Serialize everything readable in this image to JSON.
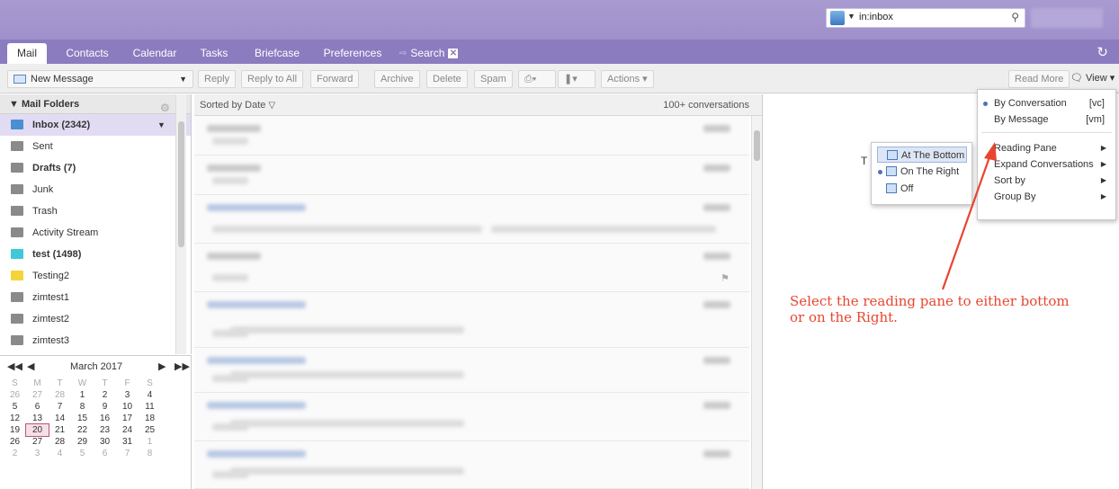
{
  "header": {
    "search": {
      "value": "in:inbox",
      "type_icon": "mail-search-type-icon",
      "search_icon": "magnifier-icon"
    },
    "search_button": ""
  },
  "tabs": [
    {
      "label": "Mail",
      "active": true
    },
    {
      "label": "Contacts"
    },
    {
      "label": "Calendar"
    },
    {
      "label": "Tasks"
    },
    {
      "label": "Briefcase"
    },
    {
      "label": "Preferences"
    },
    {
      "label": "Search",
      "closable": true
    }
  ],
  "toolbar": {
    "new_message": "New Message",
    "reply": "Reply",
    "reply_all": "Reply to All",
    "forward": "Forward",
    "archive": "Archive",
    "delete": "Delete",
    "spam": "Spam",
    "actions": "Actions",
    "read_more": "Read More",
    "view": "View"
  },
  "folders": {
    "title": "Mail Folders",
    "items": [
      {
        "label": "Inbox (2342)",
        "icon": "inbox-icon",
        "color": "#4a8fd4"
      },
      {
        "label": "Sent",
        "icon": "sent-folder-icon",
        "color": "#8a8a8a"
      },
      {
        "label": "Drafts (7)",
        "icon": "drafts-folder-icon",
        "color": "#8a8a8a"
      },
      {
        "label": "Junk",
        "icon": "junk-folder-icon",
        "color": "#8a8a8a"
      },
      {
        "label": "Trash",
        "icon": "trash-icon",
        "color": "#8a8a8a"
      },
      {
        "label": "Activity Stream",
        "icon": "folder-icon",
        "color": "#8a8a8a"
      },
      {
        "label": "test (1498)",
        "icon": "folder-icon",
        "color": "#3ec8d8"
      },
      {
        "label": "Testing2",
        "icon": "folder-icon",
        "color": "#f3d53a"
      },
      {
        "label": "zimtest1",
        "icon": "folder-icon",
        "color": "#8a8a8a"
      },
      {
        "label": "zimtest2",
        "icon": "folder-icon",
        "color": "#8a8a8a"
      },
      {
        "label": "zimtest3",
        "icon": "folder-icon",
        "color": "#8a8a8a"
      }
    ]
  },
  "calendar": {
    "month": "March 2017",
    "weekdays": [
      "S",
      "M",
      "T",
      "W",
      "T",
      "F",
      "S"
    ],
    "days": [
      [
        "26",
        "27",
        "28",
        "1",
        "2",
        "3",
        "4"
      ],
      [
        "5",
        "6",
        "7",
        "8",
        "9",
        "10",
        "11"
      ],
      [
        "12",
        "13",
        "14",
        "15",
        "16",
        "17",
        "18"
      ],
      [
        "19",
        "20",
        "21",
        "22",
        "23",
        "24",
        "25"
      ],
      [
        "26",
        "27",
        "28",
        "29",
        "30",
        "31",
        "1"
      ],
      [
        "2",
        "3",
        "4",
        "5",
        "6",
        "7",
        "8"
      ]
    ],
    "today": "20"
  },
  "list": {
    "sorted_by": "Sorted by Date",
    "count": "100+ conversations"
  },
  "view_menu": {
    "by_conversation": "By Conversation",
    "by_conversation_shortcut": "[vc]",
    "by_message": "By Message",
    "by_message_shortcut": "[vm]",
    "reading_pane": "Reading Pane",
    "expand_conversations": "Expand Conversations",
    "sort_by": "Sort by",
    "group_by": "Group By"
  },
  "reading_pane_menu": {
    "at_bottom": "At The Bottom",
    "on_right": "On The Right",
    "off": "Off"
  },
  "reading_pane": {
    "partial_text": "T"
  },
  "annotation": {
    "text": "Select the reading pane to either bottom\nor on the Right.",
    "color": "#e8452f"
  }
}
